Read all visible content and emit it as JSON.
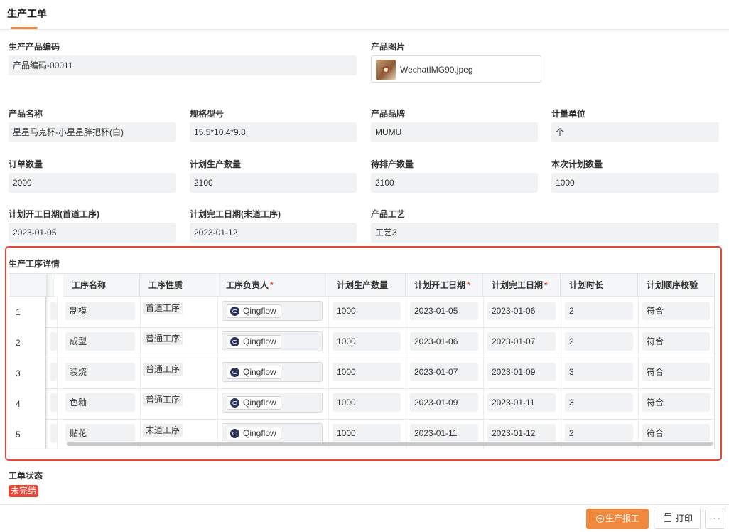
{
  "tabs": [
    {
      "label": "生产工单",
      "active": true
    }
  ],
  "fields": {
    "product_code": {
      "label": "生产产品编码",
      "value": "产品编码-00011"
    },
    "product_image": {
      "label": "产品图片",
      "file_name": "WechatIMG90.jpeg"
    },
    "product_name": {
      "label": "产品名称",
      "value": "星星马克杯-小星星胖把杯(白)"
    },
    "spec": {
      "label": "规格型号",
      "value": "15.5*10.4*9.8"
    },
    "brand": {
      "label": "产品品牌",
      "value": "MUMU"
    },
    "unit": {
      "label": "计量单位",
      "value": "个"
    },
    "order_qty": {
      "label": "订单数量",
      "value": "2000"
    },
    "planned_qty": {
      "label": "计划生产数量",
      "value": "2100"
    },
    "pending_qty": {
      "label": "待排产数量",
      "value": "2100"
    },
    "this_plan_qty": {
      "label": "本次计划数量",
      "value": "1000"
    },
    "plan_start": {
      "label": "计划开工日期(首道工序)",
      "value": "2023-01-05"
    },
    "plan_end": {
      "label": "计划完工日期(末道工序)",
      "value": "2023-01-12"
    },
    "craft": {
      "label": "产品工艺",
      "value": "工艺3"
    }
  },
  "process_table": {
    "title": "生产工序详情",
    "columns": [
      {
        "label": "工序名称",
        "required": false
      },
      {
        "label": "工序性质",
        "required": false
      },
      {
        "label": "工序负责人",
        "required": true
      },
      {
        "label": "计划生产数量",
        "required": false
      },
      {
        "label": "计划开工日期",
        "required": true
      },
      {
        "label": "计划完工日期",
        "required": true
      },
      {
        "label": "计划时长",
        "required": false
      },
      {
        "label": "计划顺序校验",
        "required": false
      }
    ],
    "required_mark": "*",
    "rows": [
      {
        "num": "1",
        "name": "制模",
        "nature": "首道工序",
        "owner": "Qingflow",
        "qty": "1000",
        "start": "2023-01-05",
        "end": "2023-01-06",
        "duration": "2",
        "check": "符合"
      },
      {
        "num": "2",
        "name": "成型",
        "nature": "普通工序",
        "owner": "Qingflow",
        "qty": "1000",
        "start": "2023-01-06",
        "end": "2023-01-07",
        "duration": "2",
        "check": "符合"
      },
      {
        "num": "3",
        "name": "装烧",
        "nature": "普通工序",
        "owner": "Qingflow",
        "qty": "1000",
        "start": "2023-01-07",
        "end": "2023-01-09",
        "duration": "3",
        "check": "符合"
      },
      {
        "num": "4",
        "name": "色釉",
        "nature": "普通工序",
        "owner": "Qingflow",
        "qty": "1000",
        "start": "2023-01-09",
        "end": "2023-01-11",
        "duration": "3",
        "check": "符合"
      },
      {
        "num": "5",
        "name": "贴花",
        "nature": "末道工序",
        "owner": "Qingflow",
        "qty": "1000",
        "start": "2023-01-11",
        "end": "2023-01-12",
        "duration": "2",
        "check": "符合"
      }
    ]
  },
  "status": {
    "label": "工单状态",
    "value": "未完结",
    "color": "#e5483a"
  },
  "footer": {
    "report_label": "生产报工",
    "print_label": "打印",
    "more_label": "···"
  },
  "colors": {
    "accent": "#f0883e",
    "highlight_border": "#e5483a"
  }
}
